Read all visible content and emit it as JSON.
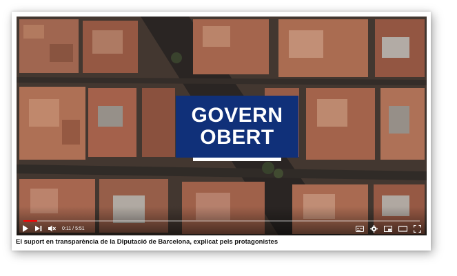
{
  "video": {
    "title_line1": "GOVERN",
    "title_line2": "OBERT",
    "brand_color": "#103079",
    "progress_fraction": 0.035,
    "progress_color": "#ff0000",
    "time_current": "0:11",
    "time_separator": "/",
    "time_total": "5:51",
    "controls": {
      "left": [
        "play-icon",
        "next-icon",
        "volume-muted-icon"
      ],
      "right": [
        "subtitles-icon",
        "settings-icon",
        "miniplayer-icon",
        "theater-mode-icon",
        "fullscreen-icon"
      ]
    }
  },
  "caption": "El suport en transparència de la Diputació de Barcelona, explicat pels protagonistes"
}
